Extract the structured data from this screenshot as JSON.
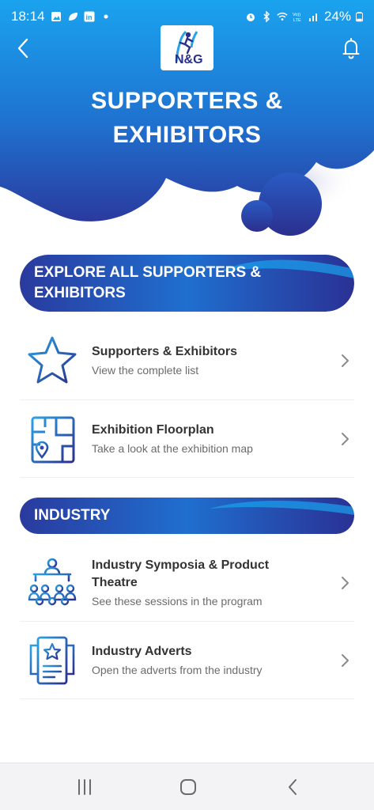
{
  "status_bar": {
    "time": "18:14",
    "battery": "24%",
    "icons": [
      "gallery-icon",
      "leaf-icon",
      "linkedin-icon",
      "dot-icon",
      "alarm-icon",
      "bluetooth-icon",
      "wifi-icon",
      "volte-icon",
      "signal-icon",
      "battery-icon"
    ]
  },
  "header": {
    "logo_text": "N&G",
    "title_line1": "SUPPORTERS &",
    "title_line2": "EXHIBITORS"
  },
  "sections": [
    {
      "label_line1": "EXPLORE ALL SUPPORTERS &",
      "label_line2": "EXHIBITORS",
      "items": [
        {
          "title": "Supporters & Exhibitors",
          "subtitle": "View the complete list",
          "icon": "star-icon"
        },
        {
          "title": "Exhibition Floorplan",
          "subtitle": "Take a look at the exhibition map",
          "icon": "floorplan-map-icon"
        }
      ]
    },
    {
      "label_line1": "INDUSTRY",
      "items": [
        {
          "title_line1": "Industry Symposia & Product",
          "title_line2": "Theatre",
          "subtitle": "See these sessions in the program",
          "icon": "symposium-audience-icon"
        },
        {
          "title": "Industry Adverts",
          "subtitle": "Open the adverts from the industry",
          "icon": "adverts-icon"
        }
      ]
    }
  ],
  "colors": {
    "primary_blue": "#1a7fd6",
    "deep_navy": "#2a2f8c",
    "bright_blue": "#1aa3ee",
    "icon_stroke": "#3a4db0",
    "text_dark": "#333333",
    "text_muted": "#6b6b6b"
  }
}
